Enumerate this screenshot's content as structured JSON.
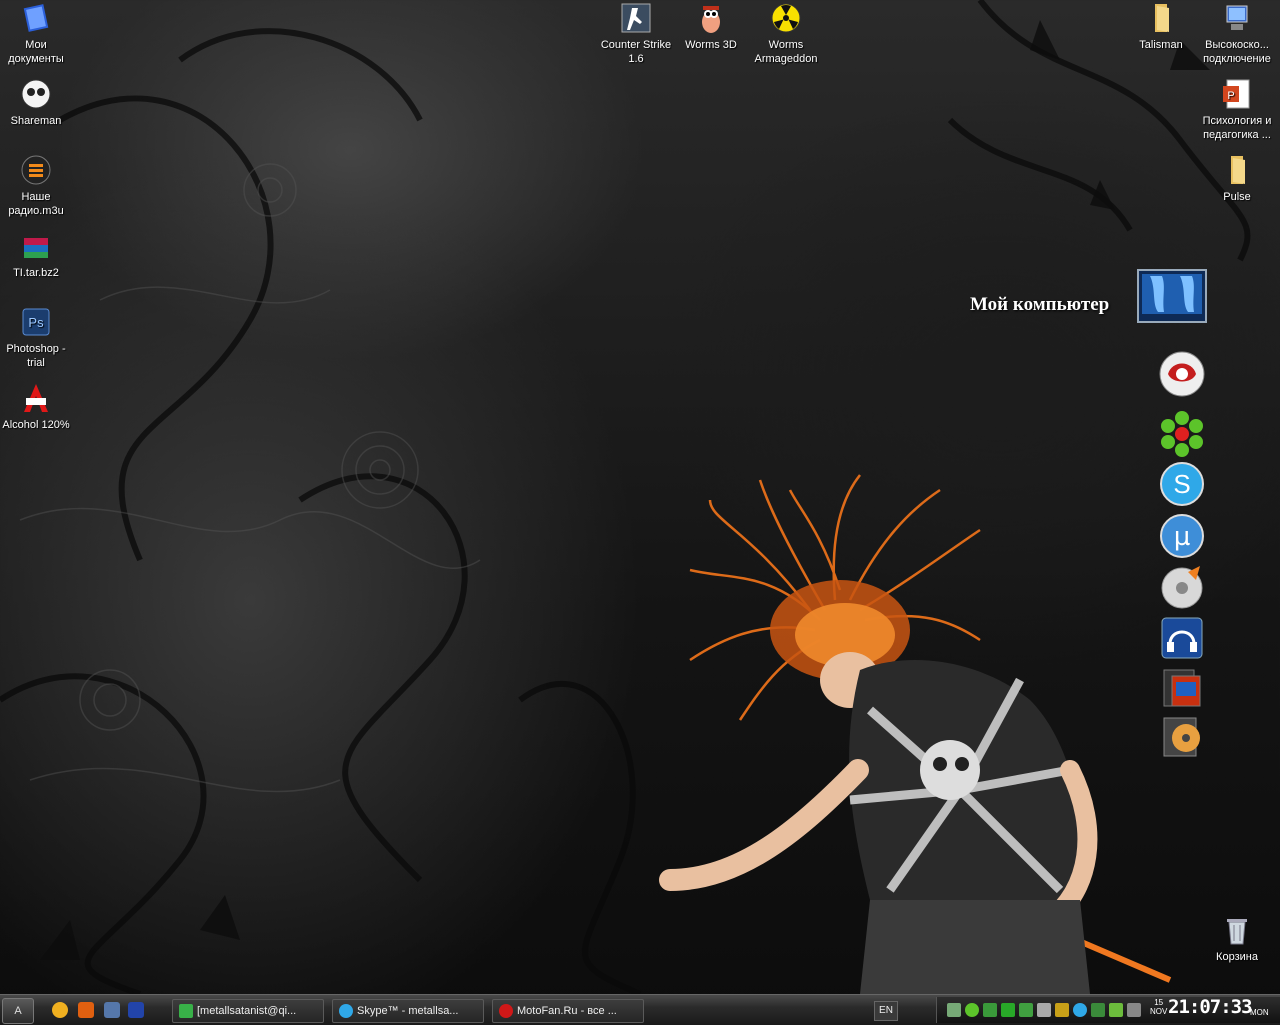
{
  "desktop": {
    "icons_left": [
      {
        "label": "Мои документы",
        "icon": "my-documents-icon"
      },
      {
        "label": "Shareman",
        "icon": "shareman-icon"
      },
      {
        "label": "Наше радио.m3u",
        "icon": "playlist-icon"
      },
      {
        "label": "TI.tar.bz2",
        "icon": "archive-icon"
      },
      {
        "label": "Photoshop - trial",
        "icon": "photoshop-icon"
      },
      {
        "label": "Alcohol 120%",
        "icon": "alcohol-icon"
      }
    ],
    "icons_top": [
      {
        "label": "Counter Strike 1.6",
        "icon": "counter-strike-icon"
      },
      {
        "label": "Worms 3D",
        "icon": "worms-3d-icon"
      },
      {
        "label": "Worms Armageddon",
        "icon": "worms-armageddon-icon"
      }
    ],
    "icons_right": [
      {
        "label": "Talisman",
        "icon": "folder-icon"
      },
      {
        "label": "Высокоско... подключение",
        "icon": "network-connection-icon"
      },
      {
        "label": "Психология и педагогика ...",
        "icon": "powerpoint-icon"
      },
      {
        "label": "Pulse",
        "icon": "folder-icon"
      }
    ],
    "recycle_bin": {
      "label": "Корзина",
      "icon": "recycle-bin-icon"
    },
    "dock": {
      "title": "Мой компьютер",
      "items": [
        "my-computer-icon",
        "opera-icon",
        "icq-icon",
        "skype-icon",
        "utorrent-icon",
        "media-player-icon",
        "audio-icon",
        "games-icon",
        "dvd-icon"
      ]
    }
  },
  "taskbar": {
    "start_label": "A",
    "quicklaunch": [
      "aim-icon",
      "media-icon",
      "display-icon",
      "desktop-icon"
    ],
    "buttons": [
      {
        "label": "[metallsatanist@qi...",
        "icon": "qip-icon"
      },
      {
        "label": "Skype™ - metallsa...",
        "icon": "skype-icon"
      },
      {
        "label": "MotoFan.Ru - все ...",
        "icon": "opera-icon"
      }
    ],
    "language": "EN",
    "tray_icons": [
      "network-icon",
      "icq-tray-icon",
      "security-icon",
      "torrent-tray-icon",
      "display-tray-icon",
      "volume-icon",
      "x-icon",
      "skype-tray-icon",
      "nvidia-icon",
      "media-tray-icon",
      "antivirus-icon"
    ],
    "date_day": "15",
    "date_month": "NOV",
    "time": "21:07:33",
    "weekday": "MON"
  },
  "colors": {
    "taskbar": "#2b2b2b",
    "hair": "#e8701a",
    "text": "#ffffff"
  }
}
